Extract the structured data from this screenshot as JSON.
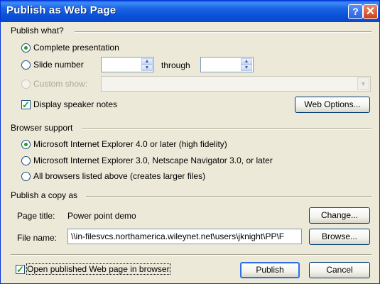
{
  "window": {
    "title": "Publish as Web Page"
  },
  "titlebar": {
    "help_glyph": "?",
    "close_glyph": "✕"
  },
  "publish_what": {
    "heading": "Publish what?",
    "complete_presentation": "Complete presentation",
    "slide_number": "Slide number",
    "slide_from_value": "",
    "through": "through",
    "slide_to_value": "",
    "custom_show": "Custom show:",
    "custom_show_value": "",
    "display_speaker_notes": "Display speaker notes",
    "web_options_button": "Web Options..."
  },
  "browser_support": {
    "heading": "Browser support",
    "option_ie4": "Microsoft Internet Explorer 4.0 or later (high fidelity)",
    "option_ie3": "Microsoft Internet Explorer 3.0, Netscape Navigator 3.0, or later",
    "option_all": "All browsers listed above (creates larger files)"
  },
  "publish_copy": {
    "heading": "Publish a copy as",
    "page_title_label": "Page title:",
    "page_title_value": "Power point demo",
    "change_button": "Change...",
    "file_name_label": "File name:",
    "file_name_value": "\\\\in-filesvcs.northamerica.wileynet.net\\users\\jknight\\PP\\F",
    "browse_button": "Browse..."
  },
  "footer": {
    "open_in_browser": "Open published Web page in browser",
    "publish_button": "Publish",
    "cancel_button": "Cancel"
  },
  "state": {
    "complete_presentation_checked": true,
    "display_speaker_notes_checked": true,
    "ie4_checked": true,
    "open_in_browser_checked": true
  },
  "colors": {
    "titlebar": "#0a52d8",
    "dialog_bg": "#ece9d8",
    "radio_dot": "#21a121",
    "checkmark": "#21a121"
  }
}
